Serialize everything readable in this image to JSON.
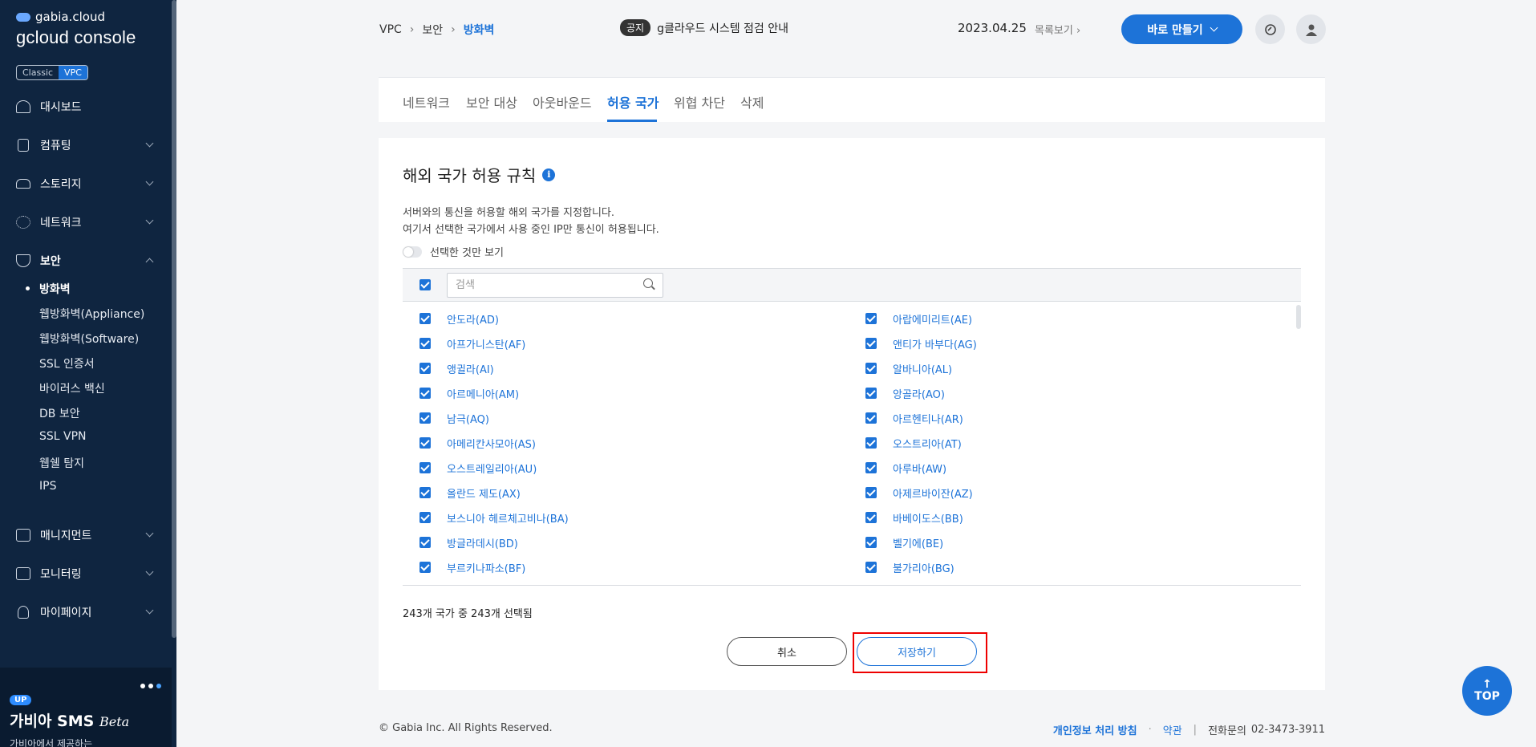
{
  "sidebar": {
    "brand_small": "gabia.cloud",
    "brand_big": "gcloud console",
    "mode_classic": "Classic",
    "mode_vpc": "VPC",
    "menu": [
      {
        "label": "대시보드",
        "icon": "dashboard-icon",
        "top": 0
      },
      {
        "label": "컴퓨팅",
        "icon": "computing-icon"
      },
      {
        "label": "스토리지",
        "icon": "storage-icon"
      },
      {
        "label": "네트워크",
        "icon": "network-icon"
      },
      {
        "label": "보안",
        "icon": "shield-icon"
      },
      {
        "label": "매니지먼트",
        "icon": "management-icon"
      },
      {
        "label": "모니터링",
        "icon": "monitoring-icon"
      },
      {
        "label": "마이페이지",
        "icon": "user-icon"
      }
    ],
    "security_sub": [
      "방화벽",
      "웹방화벽(Appliance)",
      "웹방화벽(Software)",
      "SSL 인증서",
      "바이러스 백신",
      "DB 보안",
      "SSL VPN",
      "웹쉘 탐지",
      "IPS"
    ],
    "banner": {
      "badge": "UP",
      "title": "가비아 SMS",
      "title_em": "Beta",
      "sub": "가비아에서 제공하는"
    }
  },
  "header": {
    "breadcrumb": [
      "VPC",
      "보안",
      "방화벽"
    ],
    "notice_badge": "공지",
    "notice_text": "g클라우드 시스템 점검 안내",
    "notice_date": "2023.04.25",
    "notice_more": "목록보기",
    "make_button": "바로 만들기"
  },
  "tabs": [
    "네트워크",
    "보안 대상",
    "아웃바운드",
    "허용 국가",
    "위협 차단",
    "삭제"
  ],
  "active_tab": "허용 국가",
  "section": {
    "title": "해외 국가 허용 규칙",
    "desc1": "서버와의 통신을 허용할 해외 국가를 지정합니다.",
    "desc2": "여기서 선택한 국가에서 사용 중인 IP만 통신이 허용됩니다.",
    "switch_label": "선택한 것만 보기",
    "search_placeholder": "검색",
    "countries_left": [
      "안도라(AD)",
      "아프가니스탄(AF)",
      "앵귈라(AI)",
      "아르메니아(AM)",
      "남극(AQ)",
      "아메리칸사모아(AS)",
      "오스트레일리아(AU)",
      "올란드 제도(AX)",
      "보스니아 헤르체고비나(BA)",
      "방글라데시(BD)",
      "부르키나파소(BF)"
    ],
    "countries_right": [
      "아랍에미리트(AE)",
      "앤티가 바부다(AG)",
      "알바니아(AL)",
      "앙골라(AO)",
      "아르헨티나(AR)",
      "오스트리아(AT)",
      "아루바(AW)",
      "아제르바이잔(AZ)",
      "바베이도스(BB)",
      "벨기에(BE)",
      "불가리아(BG)"
    ],
    "count_text": "243개 국가 중 243개 선택됨",
    "cancel": "취소",
    "save": "저장하기"
  },
  "footer": {
    "copyright": "© Gabia Inc. All Rights Reserved.",
    "privacy": "개인정보 처리 방침",
    "terms": "약관",
    "phone_label": "전화문의",
    "phone": "02-3473-3911"
  },
  "top_button": "TOP",
  "colors": {
    "accent": "#1d73d8",
    "sidebar": "#0f2540",
    "highlight": "#e00000"
  }
}
